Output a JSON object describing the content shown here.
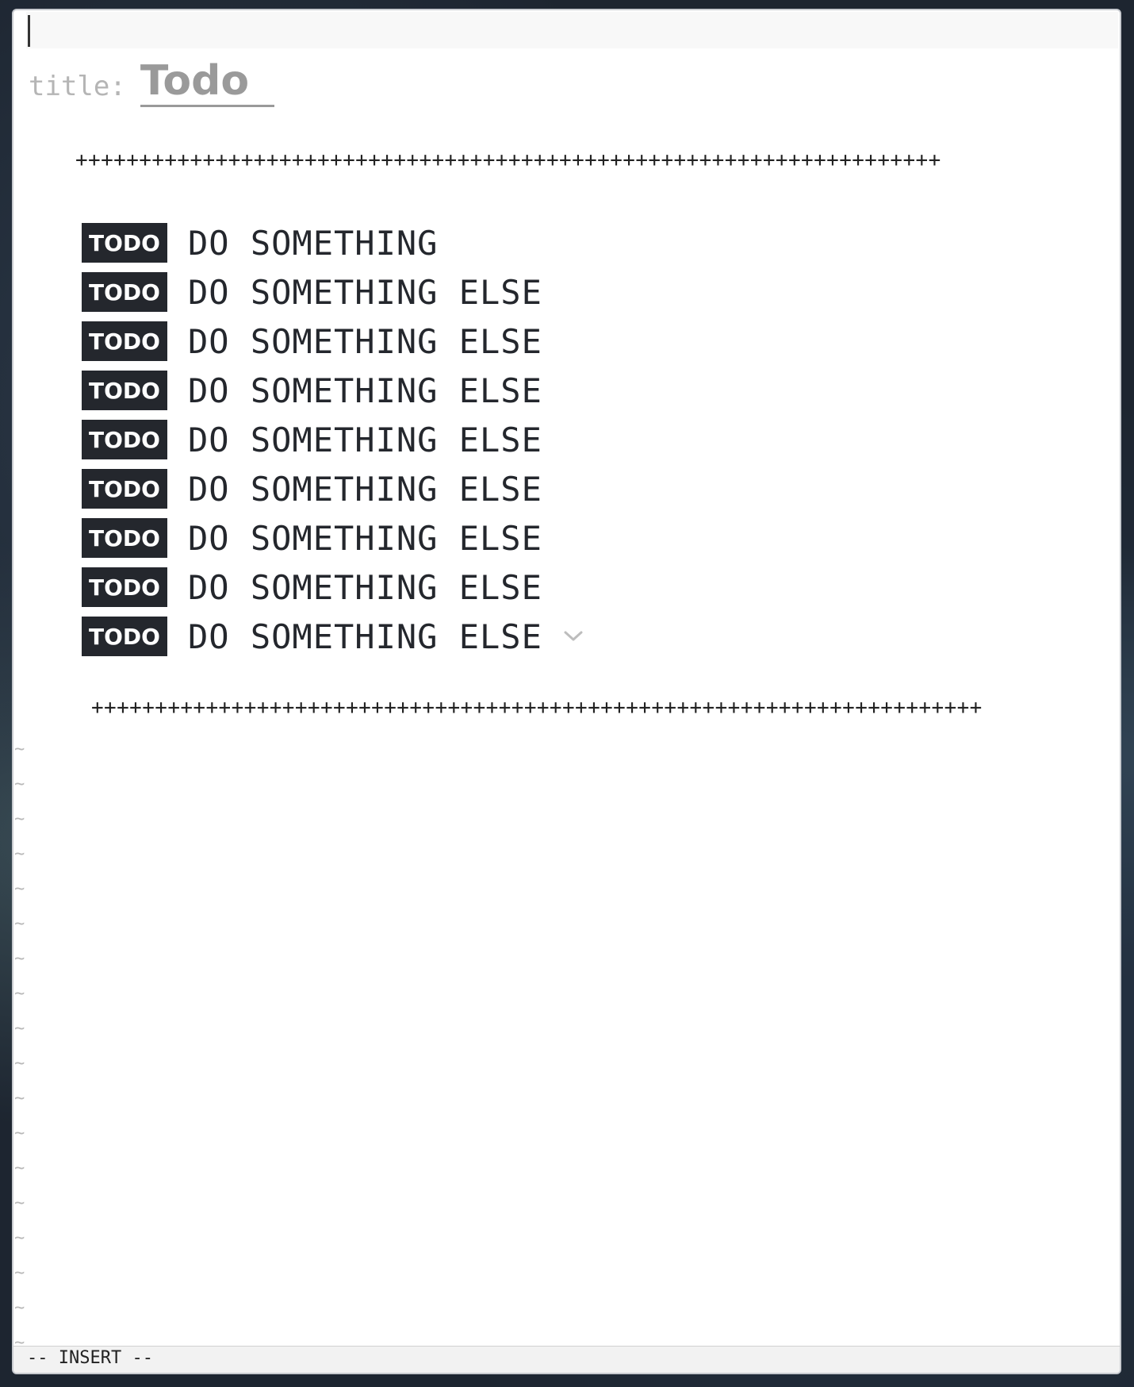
{
  "editor": {
    "command_line": "",
    "frontmatter": {
      "key": "title:",
      "value": "Todo"
    },
    "divider_top": "++++++++++++++++++++++++++++++++++++++++++++++++++++++++++++++++++++",
    "divider_bottom": "++++++++++++++++++++++++++++++++++++++++++++++++++++++++++++++++++++++",
    "todos": [
      {
        "tag": "TODO",
        "text": "DO SOMETHING"
      },
      {
        "tag": "TODO",
        "text": "DO SOMETHING ELSE"
      },
      {
        "tag": "TODO",
        "text": "DO SOMETHING ELSE"
      },
      {
        "tag": "TODO",
        "text": "DO SOMETHING ELSE"
      },
      {
        "tag": "TODO",
        "text": "DO SOMETHING ELSE"
      },
      {
        "tag": "TODO",
        "text": "DO SOMETHING ELSE"
      },
      {
        "tag": "TODO",
        "text": "DO SOMETHING ELSE"
      },
      {
        "tag": "TODO",
        "text": "DO SOMETHING ELSE"
      },
      {
        "tag": "TODO",
        "text": "DO SOMETHING ELSE"
      }
    ],
    "last_item_icon": "chevron-down-icon",
    "empty_line_marker": "~",
    "empty_line_count": 18
  },
  "statusbar": {
    "mode": "-- INSERT --"
  },
  "colors": {
    "badge_bg": "#24272d",
    "badge_fg": "#ffffff",
    "title_color": "#9a9a9a",
    "key_color": "#b5b5b5",
    "tilde_color": "#b8b8b8"
  }
}
